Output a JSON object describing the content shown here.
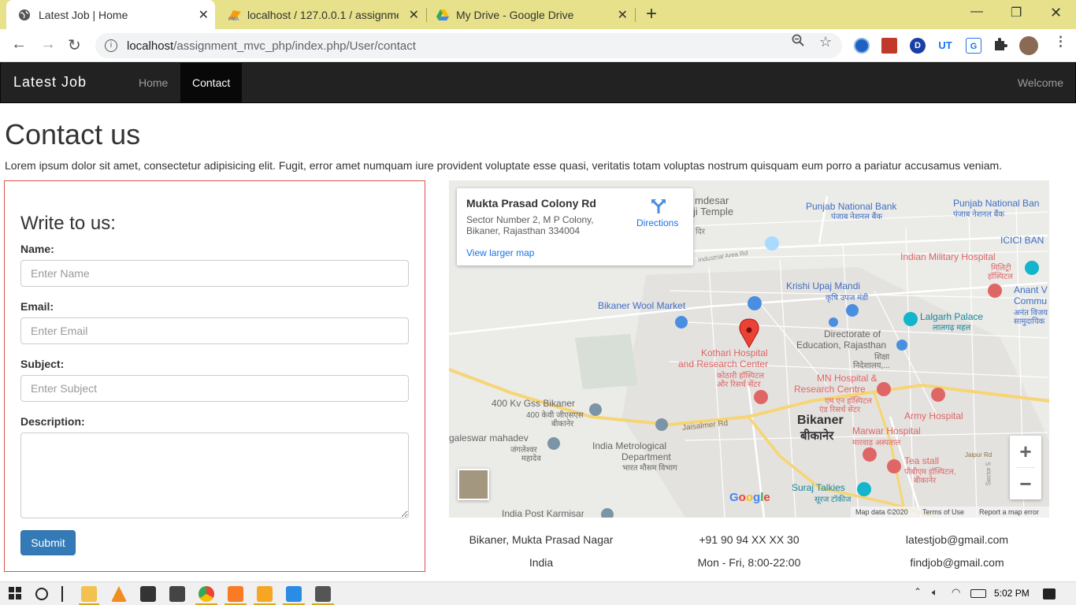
{
  "browser": {
    "tabs": [
      {
        "title": "Latest Job | Home",
        "active": true
      },
      {
        "title": "localhost / 127.0.0.1 / assignment",
        "active": false
      },
      {
        "title": "My Drive - Google Drive",
        "active": false
      }
    ],
    "url_host": "localhost",
    "url_path": "/assignment_mvc_php/index.php/User/contact",
    "extensions": [
      "D",
      "UT",
      "G"
    ]
  },
  "navbar": {
    "brand": "Latest Job",
    "links": [
      {
        "label": "Home",
        "active": false
      },
      {
        "label": "Contact",
        "active": true
      }
    ],
    "welcome": "Welcome"
  },
  "page": {
    "title": "Contact us",
    "lead": "Lorem ipsum dolor sit amet, consectetur adipisicing elit. Fugit, error amet numquam iure provident voluptate esse quasi, veritatis totam voluptas nostrum quisquam eum porro a pariatur accusamus veniam."
  },
  "form": {
    "heading": "Write to us:",
    "name_label": "Name:",
    "name_placeholder": "Enter Name",
    "email_label": "Email:",
    "email_placeholder": "Enter Email",
    "subject_label": "Subject:",
    "subject_placeholder": "Enter Subject",
    "description_label": "Description:",
    "submit": "Submit"
  },
  "map": {
    "card_title": "Mukta Prasad Colony Rd",
    "card_address": "Sector Number 2, M P Colony, Bikaner, Rajasthan 334004",
    "directions": "Directions",
    "view_larger": "View larger map",
    "labels": {
      "mdesar": "mdesar",
      "temple": "ji Temple",
      "dr": "दिर",
      "punjab1": "Punjab National Bank",
      "punjab1_hi": "पंजाब नेशनल बैंक",
      "punjab2": "Punjab National Ban",
      "punjab2_hi": "पंजाब नेशनल बैंक",
      "icici": "ICICI BAN",
      "indian_military": "Indian Military Hospital",
      "military_hi1": "मिलिट्री",
      "military_hi2": "हॉस्पिटल",
      "industrial": "Industrial Area Rd",
      "krishi": "Krishi Upaj Mandi",
      "krishi_hi": "कृषि उपज मंडी",
      "anant1": "Anant V",
      "anant2": "Commu",
      "anant_hi1": "अनंत विजय",
      "anant_hi2": "सामुदायिक",
      "woolmarket": "Bikaner Wool Market",
      "lalgarh": "Lalgarh Palace",
      "lalgarh_hi": "लालगढ़ महल",
      "kothari1": "Kothari Hospital",
      "kothari2": "and Research Center",
      "kothari_hi1": "कोठारी हॉस्पिटल",
      "kothari_hi2": "और रिसर्च सेंटर",
      "directorate1": "Directorate of",
      "directorate2": "Education, Rajasthan",
      "directorate_hi1": "शिक्षा",
      "directorate_hi2": "निदेशालय,...",
      "mn1": "MN Hospital &",
      "mn2": "Research Centre",
      "mn_hi1": "एम एन हॉस्पिटल",
      "mn_hi2": "एंड रिसर्च सेंटर",
      "army": "Army Hospital",
      "gss": "400 Kv Gss Bikaner",
      "gss_hi1": "400 केवी जीएसएस",
      "gss_hi2": "बीकानेर",
      "jaisalmer": "Jaisalmer Rd",
      "bikaner": "Bikaner",
      "bikaner_hi": "बीकानेर",
      "marwar": "Marwar Hospital",
      "marwar_hi": "मारवाड़ अस्पताल",
      "galeswar": "galeswar mahadev",
      "galeswar_hi1": "जंगलेश्वर",
      "galeswar_hi2": "महादेव",
      "meteorological1": "India Metrological",
      "meteorological2": "Department",
      "meteorological_hi": "भारत मौसम विभाग",
      "teastall": "Tea stall",
      "teastall_hi1": "पीबीएम हॉस्पिटल,",
      "teastall_hi2": "बीकानेर",
      "jaipur": "Jaipur Rd",
      "sector5": "Sector 5",
      "suraj": "Suraj Talkies",
      "suraj_hi": "सूरज टॉकीज",
      "postkarmisar": "India Post Karmisar"
    },
    "footer": {
      "mapdata": "Map data ©2020",
      "terms": "Terms of Use",
      "report": "Report a map error"
    },
    "google": "Google"
  },
  "contact": {
    "address1": "Bikaner, Mukta Prasad Nagar",
    "address2": "India",
    "phone": "+91 90 94 XX XX 30",
    "hours": "Mon - Fri, 8:00-22:00",
    "email1": "latestjob@gmail.com",
    "email2": "findjob@gmail.com"
  },
  "taskbar": {
    "time": "5:02 PM"
  },
  "colors": {
    "navbar_bg": "#222222",
    "panel_border": "#d9534f",
    "primary": "#337ab7",
    "tabbar": "#e6e18a",
    "map_pin": "#ea4335",
    "map_poi_red": "#e06666",
    "map_poi_blue": "#4a8ee0",
    "map_poi_teal": "#12b5cb"
  },
  "icons": [
    "globe-icon",
    "pma-icon",
    "drive-icon",
    "back-icon",
    "forward-icon",
    "reload-icon",
    "info-icon",
    "zoom-icon",
    "star-icon",
    "puzzle-icon",
    "kebab-menu-icon",
    "directions-icon",
    "map-pin-icon",
    "windows-start-icon",
    "chrome-icon",
    "vscode-icon"
  ]
}
